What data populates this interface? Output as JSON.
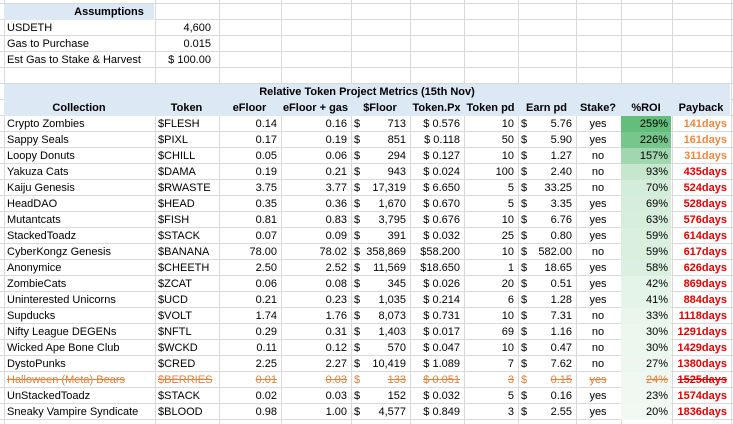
{
  "assumptions": {
    "title": "Assumptions",
    "rows": [
      {
        "label": "USDETH",
        "value": "4,600"
      },
      {
        "label": "Gas to Purchase",
        "value": "0.015"
      },
      {
        "label": "Est Gas to Stake & Harvest",
        "value": "$  100.00"
      }
    ]
  },
  "table": {
    "title": "Relative Token Project Metrics (15th Nov)",
    "headers": [
      "Collection",
      "Token",
      "eFloor",
      "eFloor + gas",
      "$Floor",
      "Token.Px",
      "Token pd",
      "Earn pd",
      "Stake?",
      "%ROI",
      "Payback"
    ],
    "rows": [
      {
        "collection": "Crypto Zombies",
        "token": "$FLESH",
        "efloor": "0.14",
        "efloor_gas": "0.16",
        "floor_usd": "713",
        "token_px": "$ 0.576",
        "token_pd": "10",
        "earn_pd": "5.76",
        "stake": "yes",
        "roi_label": "259%",
        "roi": 259,
        "payback": "141days",
        "struck": false
      },
      {
        "collection": "Sappy Seals",
        "token": "$PIXL",
        "efloor": "0.17",
        "efloor_gas": "0.19",
        "floor_usd": "851",
        "token_px": "$ 0.118",
        "token_pd": "50",
        "earn_pd": "5.90",
        "stake": "yes",
        "roi_label": "226%",
        "roi": 226,
        "payback": "161days",
        "struck": false
      },
      {
        "collection": "Loopy Donuts",
        "token": "$CHILL",
        "efloor": "0.05",
        "efloor_gas": "0.06",
        "floor_usd": "294",
        "token_px": "$ 0.127",
        "token_pd": "10",
        "earn_pd": "1.27",
        "stake": "no",
        "roi_label": "157%",
        "roi": 157,
        "payback": "311days",
        "struck": false
      },
      {
        "collection": "Yakuza Cats",
        "token": "$DAMA",
        "efloor": "0.19",
        "efloor_gas": "0.21",
        "floor_usd": "943",
        "token_px": "$ 0.024",
        "token_pd": "100",
        "earn_pd": "2.40",
        "stake": "no",
        "roi_label": "93%",
        "roi": 93,
        "payback": "435days",
        "struck": false
      },
      {
        "collection": "Kaiju Genesis",
        "token": "$RWASTE",
        "efloor": "3.75",
        "efloor_gas": "3.77",
        "floor_usd": "17,319",
        "token_px": "$ 6.650",
        "token_pd": "5",
        "earn_pd": "33.25",
        "stake": "no",
        "roi_label": "70%",
        "roi": 70,
        "payback": "524days",
        "struck": false
      },
      {
        "collection": "HeadDAO",
        "token": "$HEAD",
        "efloor": "0.35",
        "efloor_gas": "0.36",
        "floor_usd": "1,670",
        "token_px": "$ 0.670",
        "token_pd": "5",
        "earn_pd": "3.35",
        "stake": "yes",
        "roi_label": "69%",
        "roi": 69,
        "payback": "528days",
        "struck": false
      },
      {
        "collection": "Mutantcats",
        "token": "$FISH",
        "efloor": "0.81",
        "efloor_gas": "0.83",
        "floor_usd": "3,795",
        "token_px": "$ 0.676",
        "token_pd": "10",
        "earn_pd": "6.76",
        "stake": "yes",
        "roi_label": "63%",
        "roi": 63,
        "payback": "576days",
        "struck": false
      },
      {
        "collection": "StackedToadz",
        "token": "$STACK",
        "efloor": "0.07",
        "efloor_gas": "0.09",
        "floor_usd": "391",
        "token_px": "$ 0.032",
        "token_pd": "25",
        "earn_pd": "0.80",
        "stake": "yes",
        "roi_label": "59%",
        "roi": 59,
        "payback": "614days",
        "struck": false
      },
      {
        "collection": "CyberKongz Genesis",
        "token": "$BANANA",
        "efloor": "78.00",
        "efloor_gas": "78.02",
        "floor_usd": "358,869",
        "token_px": "$58.200",
        "token_pd": "10",
        "earn_pd": "582.00",
        "stake": "no",
        "roi_label": "59%",
        "roi": 59,
        "payback": "617days",
        "struck": false
      },
      {
        "collection": "Anonymice",
        "token": "$CHEETH",
        "efloor": "2.50",
        "efloor_gas": "2.52",
        "floor_usd": "11,569",
        "token_px": "$18.650",
        "token_pd": "1",
        "earn_pd": "18.65",
        "stake": "yes",
        "roi_label": "58%",
        "roi": 58,
        "payback": "626days",
        "struck": false
      },
      {
        "collection": "ZombieCats",
        "token": "$ZCAT",
        "efloor": "0.06",
        "efloor_gas": "0.08",
        "floor_usd": "345",
        "token_px": "$ 0.026",
        "token_pd": "20",
        "earn_pd": "0.51",
        "stake": "yes",
        "roi_label": "42%",
        "roi": 42,
        "payback": "869days",
        "struck": false
      },
      {
        "collection": "Uninterested Unicorns",
        "token": "$UCD",
        "efloor": "0.21",
        "efloor_gas": "0.23",
        "floor_usd": "1,035",
        "token_px": "$ 0.214",
        "token_pd": "6",
        "earn_pd": "1.28",
        "stake": "yes",
        "roi_label": "41%",
        "roi": 41,
        "payback": "884days",
        "struck": false
      },
      {
        "collection": "Supducks",
        "token": "$VOLT",
        "efloor": "1.74",
        "efloor_gas": "1.76",
        "floor_usd": "8,073",
        "token_px": "$ 0.731",
        "token_pd": "10",
        "earn_pd": "7.31",
        "stake": "no",
        "roi_label": "33%",
        "roi": 33,
        "payback": "1118days",
        "struck": false
      },
      {
        "collection": "Nifty League DEGENs",
        "token": "$NFTL",
        "efloor": "0.29",
        "efloor_gas": "0.31",
        "floor_usd": "1,403",
        "token_px": "$ 0.017",
        "token_pd": "69",
        "earn_pd": "1.16",
        "stake": "no",
        "roi_label": "30%",
        "roi": 30,
        "payback": "1291days",
        "struck": false
      },
      {
        "collection": "Wicked Ape Bone Club",
        "token": "$WCKD",
        "efloor": "0.11",
        "efloor_gas": "0.12",
        "floor_usd": "570",
        "token_px": "$ 0.047",
        "token_pd": "10",
        "earn_pd": "0.47",
        "stake": "no",
        "roi_label": "30%",
        "roi": 30,
        "payback": "1429days",
        "struck": false
      },
      {
        "collection": "DystoPunks",
        "token": "$CRED",
        "efloor": "2.25",
        "efloor_gas": "2.27",
        "floor_usd": "10,419",
        "token_px": "$ 1.089",
        "token_pd": "7",
        "earn_pd": "7.62",
        "stake": "no",
        "roi_label": "27%",
        "roi": 27,
        "payback": "1380days",
        "struck": false
      },
      {
        "collection": "Halloween (Meta) Bears",
        "token": "$BERRIES",
        "efloor": "0.01",
        "efloor_gas": "0.03",
        "floor_usd": "133",
        "token_px": "$ 0.051",
        "token_pd": "3",
        "earn_pd": "0.15",
        "stake": "yes",
        "roi_label": "24%",
        "roi": 24,
        "payback": "1525days",
        "struck": true
      },
      {
        "collection": "UnStackedToadz",
        "token": "$STACK",
        "efloor": "0.02",
        "efloor_gas": "0.03",
        "floor_usd": "152",
        "token_px": "$ 0.032",
        "token_pd": "5",
        "earn_pd": "0.16",
        "stake": "yes",
        "roi_label": "23%",
        "roi": 23,
        "payback": "1574days",
        "struck": false
      },
      {
        "collection": "Sneaky Vampire Syndicate",
        "token": "$BLOOD",
        "efloor": "0.98",
        "efloor_gas": "1.00",
        "floor_usd": "4,577",
        "token_px": "$ 0.849",
        "token_pd": "3",
        "earn_pd": "2.55",
        "stake": "yes",
        "roi_label": "20%",
        "roi": 20,
        "payback": "1836days",
        "struck": false
      }
    ]
  },
  "colors": {
    "band": "#dde8f5",
    "grid": "#d9d9d9",
    "roi_high": "#63be7b",
    "roi_low": "#f2f9f3",
    "payback_orange": "#f0883e",
    "payback_red": "#e00000",
    "struck": "#e1813c"
  }
}
